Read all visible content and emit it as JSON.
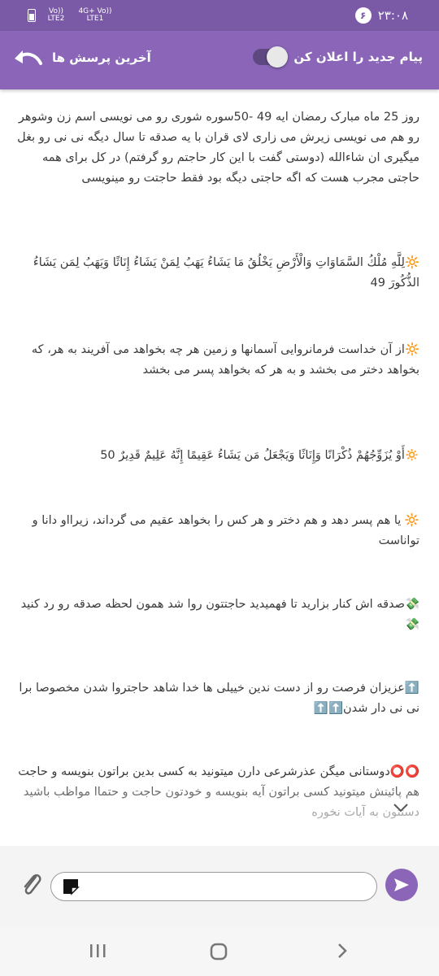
{
  "status_bar": {
    "time": "۲۳:۰۸",
    "notification_count": "۶",
    "signal1": "Vo)) LTE2",
    "signal2": "4G+ Vo)) LTE1"
  },
  "header": {
    "back_label": "آخرین پرسش ها",
    "notify_label": "پیام جدید را اعلان کن",
    "notify_enabled": false
  },
  "messages": [
    "روز 25 ماه مبارک رمضان ایه 49 -50سوره شوری رو می نویسی اسم زن وشوهر رو هم می نویسی زیرش می زاری لای قران با یه صدقه تا سال دیگه نی نی رو بغل میگیری ان شاءالله (دوستی گفت با این کار حاجتم رو گرفتم) در کل برای همه حاجتی مجرب هست که اگه حاجتی دیگه بود فقط حاجتت رو مینویسی",
    "🔆لِلَّهِ مُلْكُ السَّمَاوَاتِ وَالْأَرْضِ يَخْلُقُ مَا يَشَاءُ يَهَبُ لِمَنْ يَشَاءُ إِنَاثًا وَيَهَبُ لِمَن يَشَاءُ الذُّكُورَ 49",
    "🔆از آن خداست فرمانروایی آسمانها و زمین هر چه بخواهد می آفریند به هر، که بخواهد دختر می بخشد و به هر که بخواهد پسر می بخشد",
    "🔅أَوْ يُزَوِّجُهُمْ ذُكْرَانًا وَإِنَاثًا وَيَجْعَلُ مَن يَشَاءُ عَقِيمًا إِنَّهُ عَلِيمٌ قَدِيرٌ 50",
    "🔆 یا هم پسر دهد و هم دختر و هر کس را بخواهد عقیم می گرداند، زیرااو دانا و تواناست",
    "💸صدقه اش کنار بزارید تا فهمیدید حاجتتون روا شد همون لحظه صدقه رو رد کنید💸",
    "⬆️عزیزان فرصت رو از دست ندین خییلی ها خدا شاهد حاجتروا شدن مخصوصا برا نی نی دار شدن⬆️⬆️",
    "⭕⭕دوستانی میگن عذرشرعی دارن میتونید به کسی بدین براتون بنویسه و حاجت هم پائینش میتونید کسی براتون آیه بنویسه و خودتون حاجت و حتماا مواظب باشید دستتون به آیات نخوره"
  ],
  "input": {
    "placeholder": ""
  },
  "colors": {
    "status_bar": "#7a5aa6",
    "app_bar": "#8a65b8",
    "send_button": "#8a65b8"
  },
  "icons": {
    "back": "curved-back-arrow-icon",
    "attach": "paperclip-icon",
    "sticker": "sticker-icon",
    "send": "send-icon",
    "scroll_down": "chevron-down-icon"
  }
}
